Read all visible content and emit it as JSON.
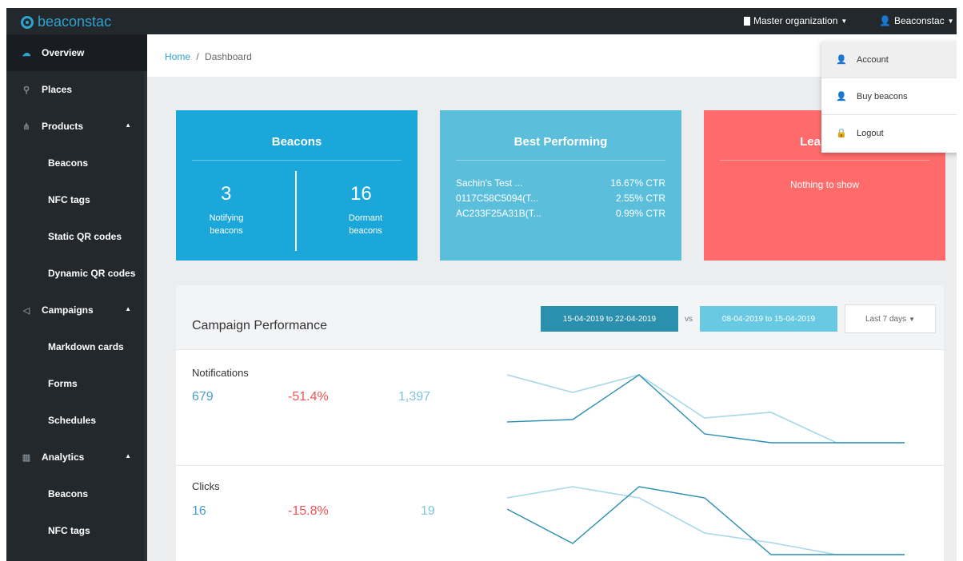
{
  "topbar": {
    "logo": "beaconstac",
    "org_label": "Master organization",
    "user_label": "Beaconstac"
  },
  "sidebar": {
    "items": [
      {
        "label": "Overview"
      },
      {
        "label": "Places"
      },
      {
        "label": "Products"
      },
      {
        "label": "Beacons"
      },
      {
        "label": "NFC tags"
      },
      {
        "label": "Static QR codes"
      },
      {
        "label": "Dynamic QR codes"
      },
      {
        "label": "Campaigns"
      },
      {
        "label": "Markdown cards"
      },
      {
        "label": "Forms"
      },
      {
        "label": "Schedules"
      },
      {
        "label": "Analytics"
      },
      {
        "label": "Beacons"
      },
      {
        "label": "NFC tags"
      }
    ]
  },
  "breadcrumb": {
    "home": "Home",
    "separator": "/",
    "current": "Dashboard"
  },
  "cards": {
    "beacons": {
      "title": "Beacons",
      "notifying_count": "3",
      "notifying_label_1": "Notifying",
      "notifying_label_2": "beacons",
      "dormant_count": "16",
      "dormant_label_1": "Dormant",
      "dormant_label_2": "beacons"
    },
    "best": {
      "title": "Best Performing",
      "rows": [
        {
          "name": "Sachin's Test ...",
          "value": "16.67% CTR"
        },
        {
          "name": "0117C58C5094(T...",
          "value": "2.55% CTR"
        },
        {
          "name": "AC233F25A31B(T...",
          "value": "0.99% CTR"
        }
      ]
    },
    "least": {
      "title": "Least Pe",
      "empty": "Nothing to show"
    }
  },
  "campaign": {
    "title": "Campaign Performance",
    "range_current": "15-04-2019 to 22-04-2019",
    "vs": "vs",
    "range_previous": "08-04-2019 to 15-04-2019",
    "period_select": "Last 7 days",
    "metrics": [
      {
        "label": "Notifications",
        "current": "679",
        "change": "-51.4%",
        "previous": "1,397"
      },
      {
        "label": "Clicks",
        "current": "16",
        "change": "-15.8%",
        "previous": "19"
      }
    ]
  },
  "user_menu": {
    "items": [
      {
        "label": "Account"
      },
      {
        "label": "Buy beacons"
      },
      {
        "label": "Logout"
      }
    ]
  },
  "colors": {
    "topbar": "#23282d",
    "accent": "#2ea3cf",
    "beacons_card": "#1ba7d9",
    "best_card": "#5bbfdc",
    "least_card": "#ff6b6b",
    "range_current": "#2a90ad",
    "range_previous": "#67c9e2",
    "negative": "#ef5350"
  }
}
